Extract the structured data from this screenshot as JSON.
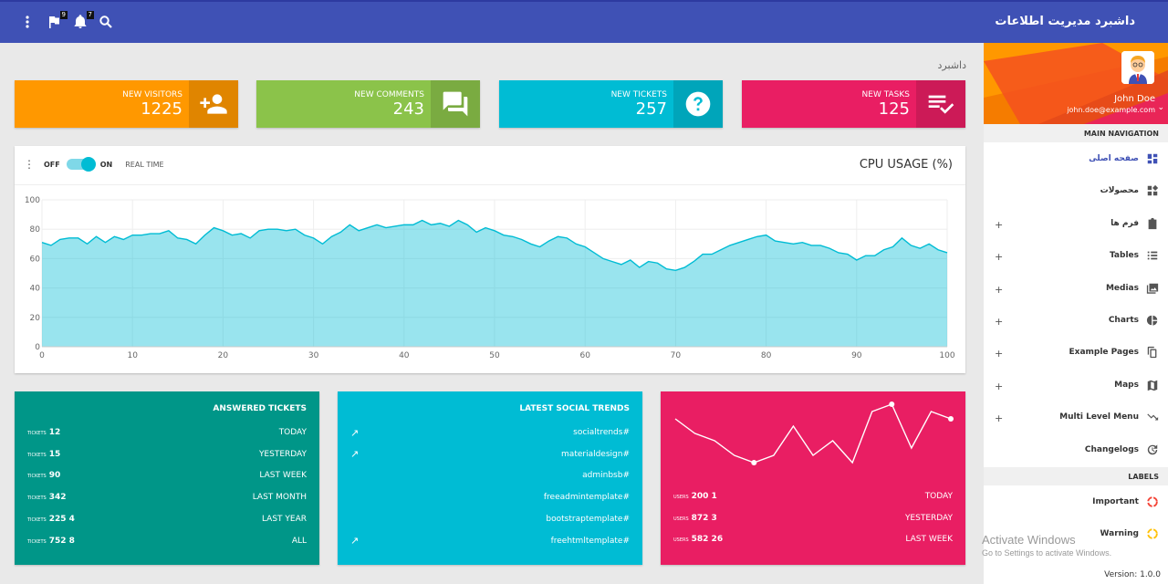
{
  "header": {
    "title": "داشبرد مدیریت اطلاعات",
    "flag_badge": "9",
    "bell_badge": "7"
  },
  "breadcrumb": "داشبرد",
  "info_boxes": [
    {
      "label": "NEW VISITORS",
      "value": "1225",
      "color": "#ff9800",
      "icon": "person-add-icon"
    },
    {
      "label": "NEW COMMENTS",
      "value": "243",
      "color": "#8bc34a",
      "icon": "forum-icon"
    },
    {
      "label": "NEW TICKETS",
      "value": "257",
      "color": "#00bcd4",
      "icon": "help-icon"
    },
    {
      "label": "NEW TASKS",
      "value": "125",
      "color": "#e91e63",
      "icon": "playlist-check-icon"
    }
  ],
  "cpu": {
    "title": "CPU USAGE (%)",
    "switch_off": "OFF",
    "switch_on": "ON",
    "switch_label": "REAL TIME"
  },
  "chart_data": {
    "type": "area",
    "title": "CPU USAGE (%)",
    "xlim": [
      0,
      100
    ],
    "ylim": [
      0,
      100
    ],
    "xticks": [
      0,
      10,
      20,
      30,
      40,
      50,
      60,
      70,
      80,
      90,
      100
    ],
    "yticks": [
      0,
      20,
      40,
      60,
      80,
      100
    ],
    "grid": true,
    "color": "#00bcd4",
    "x": [
      0,
      1,
      2,
      3,
      4,
      5,
      6,
      7,
      8,
      9,
      10,
      11,
      12,
      13,
      14,
      15,
      16,
      17,
      18,
      19,
      20,
      21,
      22,
      23,
      24,
      25,
      26,
      27,
      28,
      29,
      30,
      31,
      32,
      33,
      34,
      35,
      36,
      37,
      38,
      39,
      40,
      41,
      42,
      43,
      44,
      45,
      46,
      47,
      48,
      49,
      50,
      51,
      52,
      53,
      54,
      55,
      56,
      57,
      58,
      59,
      60,
      61,
      62,
      63,
      64,
      65,
      66,
      67,
      68,
      69,
      70,
      71,
      72,
      73,
      74,
      75,
      76,
      77,
      78,
      79,
      80,
      81,
      82,
      83,
      84,
      85,
      86,
      87,
      88,
      89,
      90,
      91,
      92,
      93,
      94,
      95,
      96,
      97,
      98,
      99,
      100
    ],
    "y": [
      71,
      69,
      73,
      74,
      74,
      70,
      75,
      71,
      75,
      73,
      76,
      76,
      77,
      77,
      79,
      74,
      73,
      70,
      76,
      81,
      79,
      76,
      77,
      74,
      79,
      80,
      80,
      79,
      80,
      76,
      74,
      70,
      75,
      78,
      83,
      79,
      81,
      83,
      81,
      82,
      83,
      83,
      86,
      83,
      84,
      82,
      86,
      83,
      78,
      81,
      79,
      76,
      75,
      73,
      70,
      68,
      72,
      75,
      74,
      70,
      68,
      64,
      60,
      58,
      56,
      59,
      54,
      58,
      57,
      53,
      52,
      54,
      58,
      63,
      63,
      66,
      69,
      71,
      73,
      75,
      76,
      72,
      71,
      70,
      71,
      69,
      69,
      67,
      64,
      63,
      59,
      62,
      62,
      66,
      68,
      74,
      69,
      67,
      70,
      66,
      64
    ]
  },
  "answered_tickets": {
    "title": "ANSWERED TICKETS",
    "unit": "TICKETS",
    "rows": [
      {
        "value": "12",
        "label": "TODAY"
      },
      {
        "value": "15",
        "label": "YESTERDAY"
      },
      {
        "value": "90",
        "label": "LAST WEEK"
      },
      {
        "value": "342",
        "label": "LAST MONTH"
      },
      {
        "value": "225 4",
        "label": "LAST YEAR"
      },
      {
        "value": "752 8",
        "label": "ALL"
      }
    ]
  },
  "social_trends": {
    "title": "LATEST SOCIAL TRENDS",
    "trend_glyph": "↗",
    "items": [
      {
        "tag": "socialtrends#",
        "trend": true
      },
      {
        "tag": "materialdesign#",
        "trend": true
      },
      {
        "tag": "adminbsb#",
        "trend": false
      },
      {
        "tag": "freeadmintemplate#",
        "trend": false
      },
      {
        "tag": "bootstraptemplate#",
        "trend": false
      },
      {
        "tag": "freehtmltemplate#",
        "trend": true
      }
    ]
  },
  "users_card": {
    "unit": "USERS",
    "sparkline": [
      8,
      6,
      5,
      3,
      2,
      3,
      7,
      3,
      5,
      2,
      9,
      10,
      4,
      9,
      8
    ],
    "rows": [
      {
        "value": "200 1",
        "label": "TODAY"
      },
      {
        "value": "872 3",
        "label": "YESTERDAY"
      },
      {
        "value": "582 26",
        "label": "LAST WEEK"
      }
    ]
  },
  "sidebar": {
    "user_name": "John Doe",
    "user_email": "john.doe@example.com",
    "nav_header": "MAIN NAVIGATION",
    "items": [
      {
        "label": "صفحه اصلی",
        "icon": "dashboard-icon",
        "expandable": false,
        "active": true
      },
      {
        "label": "محصولات",
        "icon": "widgets-icon",
        "expandable": false,
        "active": false
      },
      {
        "label": "فرم ها",
        "icon": "assignment-icon",
        "expandable": true,
        "active": false
      },
      {
        "label": "Tables",
        "icon": "list-icon",
        "expandable": true,
        "active": false
      },
      {
        "label": "Medias",
        "icon": "perm-media-icon",
        "expandable": true,
        "active": false
      },
      {
        "label": "Charts",
        "icon": "pie-chart-icon",
        "expandable": true,
        "active": false
      },
      {
        "label": "Example Pages",
        "icon": "content-copy-icon",
        "expandable": true,
        "active": false
      },
      {
        "label": "Maps",
        "icon": "map-icon",
        "expandable": true,
        "active": false
      },
      {
        "label": "Multi Level Menu",
        "icon": "trending-down-icon",
        "expandable": true,
        "active": false
      },
      {
        "label": "Changelogs",
        "icon": "update-icon",
        "expandable": false,
        "active": false
      }
    ],
    "labels_header": "LABELS",
    "labels": [
      {
        "label": "Important",
        "color": "#f44336"
      },
      {
        "label": "Warning",
        "color": "#ffc107"
      }
    ],
    "version": "Version: 1.0.0"
  },
  "watermark": {
    "line1": "Activate Windows",
    "line2": "Go to Settings to activate Windows."
  }
}
